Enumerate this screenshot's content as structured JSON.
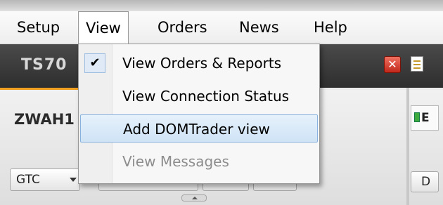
{
  "menubar": {
    "items": [
      {
        "label": "Setup"
      },
      {
        "label": "View"
      },
      {
        "label": "Orders"
      },
      {
        "label": "News"
      },
      {
        "label": "Help"
      }
    ]
  },
  "tabstrip": {
    "window_label": "TS70",
    "close_glyph": "✕"
  },
  "panel": {
    "symbol_label": "ZWAH1",
    "right_tab_label": "E",
    "tif_value": "GTC",
    "right_button_label": "D"
  },
  "view_menu": {
    "items": [
      {
        "label": "View Orders & Reports",
        "checked": true,
        "check_glyph": "✔"
      },
      {
        "label": "View Connection Status"
      },
      {
        "label": "Add DOMTrader view",
        "highlighted": true
      },
      {
        "label": "View Messages",
        "disabled": true
      }
    ]
  },
  "icons": {
    "close": "close-icon",
    "note": "note-icon",
    "check": "check-icon",
    "dropdown_arrow": "chevron-down-icon"
  },
  "colors": {
    "accent": "#f0a020",
    "close_red": "#d63a2b",
    "highlight": "#cfe3f6",
    "tabstrip": "#3a3a3a"
  }
}
